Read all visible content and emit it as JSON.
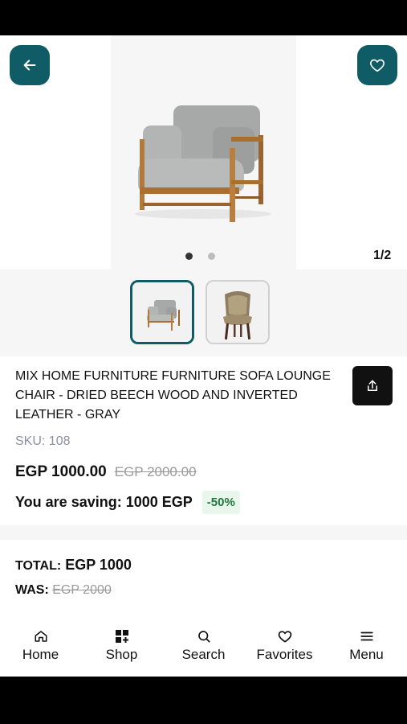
{
  "gallery": {
    "page_counter": "1/2",
    "active_index": 0,
    "dot_count": 2
  },
  "product": {
    "title": "MIX HOME FURNITURE FURNITURE SOFA LOUNGE CHAIR - DRIED BEECH WOOD AND INVERTED LEATHER - GRAY",
    "sku_label": "SKU:",
    "sku_value": "108",
    "price": "EGP 1000.00",
    "old_price": "EGP 2000.00",
    "saving_text": "You are saving: 1000 EGP",
    "discount_badge": "-50%"
  },
  "totals": {
    "total_label": "TOTAL:",
    "total_value": "EGP 1000",
    "was_label": "WAS:",
    "was_value": "EGP 2000"
  },
  "tabbar": {
    "items": [
      {
        "label": "Home",
        "icon": "home-icon"
      },
      {
        "label": "Shop",
        "icon": "shop-icon"
      },
      {
        "label": "Search",
        "icon": "search-icon"
      },
      {
        "label": "Favorites",
        "icon": "heart-icon"
      },
      {
        "label": "Menu",
        "icon": "menu-icon"
      }
    ]
  },
  "colors": {
    "accent": "#0f5b66",
    "discount_bg": "#e8f6ec",
    "discount_text": "#1d7a3e"
  }
}
